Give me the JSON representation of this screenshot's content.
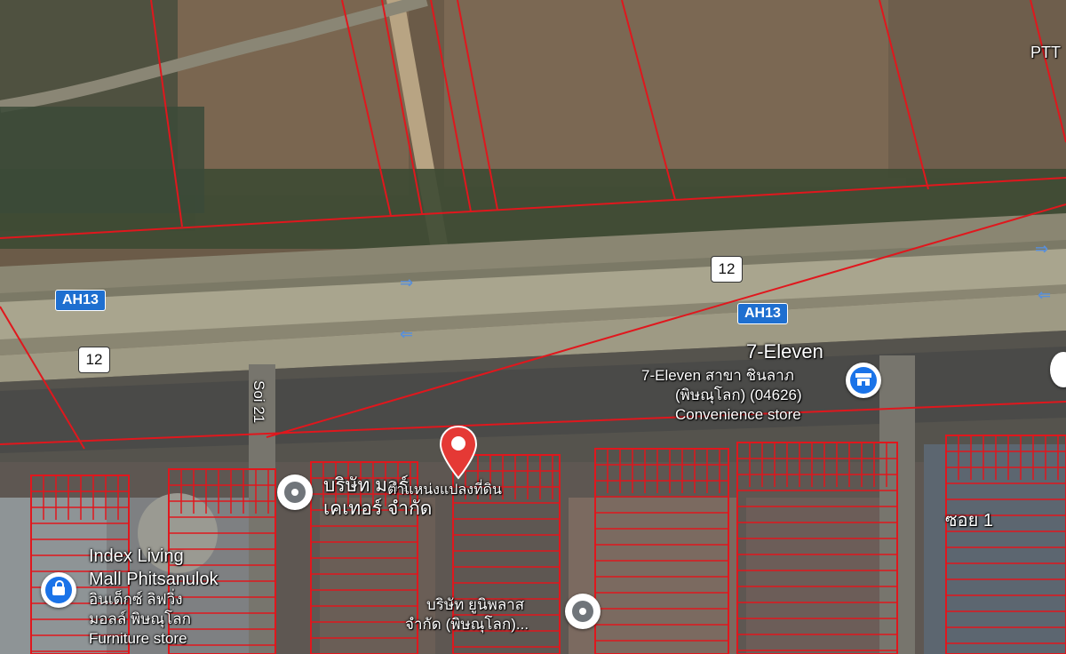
{
  "map": {
    "type": "satellite",
    "parcel_color": "#e0171d",
    "accent_blue": "#1a73e8",
    "pin_color": "#e53935"
  },
  "labels": {
    "ptt": "PTT",
    "seven_title": "7-Eleven",
    "seven_line1": "7-Eleven สาขา ชินลาภ",
    "seven_line2": "(พิษณุโลก) (04626)",
    "seven_category": "Convenience store",
    "soi21": "Soi 21",
    "company1_line1": "บริษัท มอร์",
    "company1_line2": "เคเทอร์ จำกัด",
    "pin_label": "ตำแหน่งแปลงที่ดิน",
    "soi1": "ซอย 1",
    "index_line1": "Index Living",
    "index_line2": "Mall Phitsanulok",
    "index_line3": "อินเด็กซ์ ลิฟวิ่ง",
    "index_line4": "มอลล์ พิษณุโลก",
    "index_category": "Furniture store",
    "company2_line1": "บริษัท ยูนิพลาส",
    "company2_line2": "จำกัด (พิษณุโลก)..."
  },
  "shields": {
    "ah13_left": "AH13",
    "ah13_right": "AH13",
    "r12_top": "12",
    "r12_left": "12"
  },
  "icons": {
    "pin": "map-pin-icon",
    "store": "convenience-store-icon",
    "shop": "shopping-icon",
    "poi": "generic-poi-icon",
    "arrow": "traffic-direction-arrow-icon"
  }
}
